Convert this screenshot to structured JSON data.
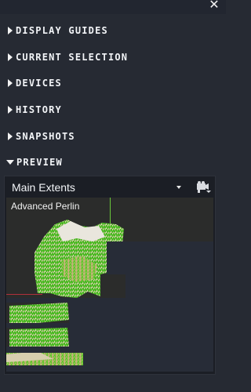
{
  "window": {
    "close_glyph": "✕"
  },
  "sections": [
    {
      "label": "DISPLAY GUIDES",
      "expanded": false
    },
    {
      "label": "CURRENT SELECTION",
      "expanded": false
    },
    {
      "label": "DEVICES",
      "expanded": false
    },
    {
      "label": "HISTORY",
      "expanded": false
    },
    {
      "label": "SNAPSHOTS",
      "expanded": false
    },
    {
      "label": "PREVIEW",
      "expanded": true
    }
  ],
  "preview": {
    "view_select": "Main Extents",
    "camera_icon": "camera-icon",
    "viewport_label": "Advanced Perlin",
    "colors": {
      "terrain_green": "#4fbf22",
      "terrain_sand": "#c9b98a",
      "axis_green": "#6ac83a",
      "axis_red": "#b0303c"
    }
  }
}
